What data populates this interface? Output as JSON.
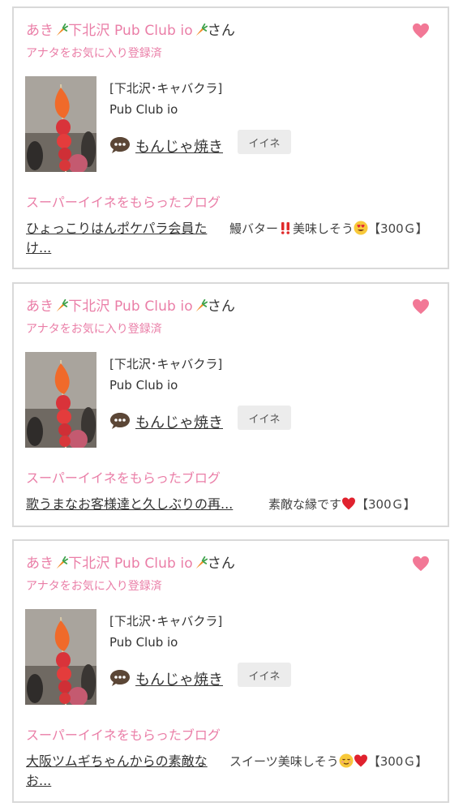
{
  "cards": [
    {
      "user_name": "あき",
      "shop_name_pink": "下北沢 Pub Club io",
      "suffix": "さん",
      "favorite_status": "アナタをお気に入り登録済",
      "genre": "[下北沢･キャバクラ]",
      "shop": "Pub Club io",
      "cast_name": "もんじゃ焼き",
      "iine_label": "イイネ",
      "section_label": "スーパーイイネをもらったブログ",
      "blog_title": "ひょっこりはんポケパラ会員たけ...",
      "comment_before": "鰻バター",
      "comment_middle": "美味しそう",
      "comment_after": "【300Ｇ】"
    },
    {
      "user_name": "あき",
      "shop_name_pink": "下北沢 Pub Club io",
      "suffix": "さん",
      "favorite_status": "アナタをお気に入り登録済",
      "genre": "[下北沢･キャバクラ]",
      "shop": "Pub Club io",
      "cast_name": "もんじゃ焼き",
      "iine_label": "イイネ",
      "section_label": "スーパーイイネをもらったブログ",
      "blog_title": "歌うまなお客様達と久しぶりの再...",
      "comment_before": "素敵な縁です",
      "comment_after": "【300Ｇ】"
    },
    {
      "user_name": "あき",
      "shop_name_pink": "下北沢 Pub Club io",
      "suffix": "さん",
      "favorite_status": "アナタをお気に入り登録済",
      "genre": "[下北沢･キャバクラ]",
      "shop": "Pub Club io",
      "cast_name": "もんじゃ焼き",
      "iine_label": "イイネ",
      "section_label": "スーパーイイネをもらったブログ",
      "blog_title": "大阪ツムギちゃんからの素敵なお...",
      "comment_before": "スイーツ美味しそう",
      "comment_after": "【300Ｇ】"
    }
  ],
  "colors": {
    "pink": "#ea7ea7",
    "heart": "#f27896",
    "border": "#d9d9d9"
  },
  "icons": [
    "carrot-emoji-icon",
    "heart-icon",
    "speech-bubble-icon",
    "double-exclamation-icon",
    "heart-eyes-emoji-icon",
    "red-heart-icon",
    "relieved-face-emoji-icon"
  ]
}
